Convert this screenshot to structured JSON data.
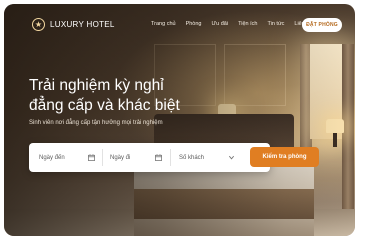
{
  "brand": {
    "name": "LUXURY HOTEL",
    "icon": "star-icon"
  },
  "nav": {
    "items": [
      "Trang chủ",
      "Phòng",
      "Ưu đãi",
      "Tiện ích",
      "Tin tức",
      "Liên hệ"
    ],
    "cta": "ĐẶT PHÒNG"
  },
  "hero": {
    "title_line1": "Trải nghiệm kỳ nghỉ",
    "title_line2": "đẳng cấp và khác biệt",
    "subtitle": "Sinh viên nơi đẳng cấp tận hưởng mọi trải nghiệm"
  },
  "search": {
    "checkin": {
      "label": "Ngày đến",
      "icon": "calendar-icon"
    },
    "checkout": {
      "label": "Ngày đi",
      "icon": "calendar-icon"
    },
    "guests": {
      "label": "Số khách",
      "icon": "chevron-down-icon"
    },
    "submit": "Kiểm tra phòng"
  },
  "colors": {
    "accent": "#e07e22",
    "brand_gold": "#f2d7a0",
    "cta_text": "#b56a1e"
  }
}
